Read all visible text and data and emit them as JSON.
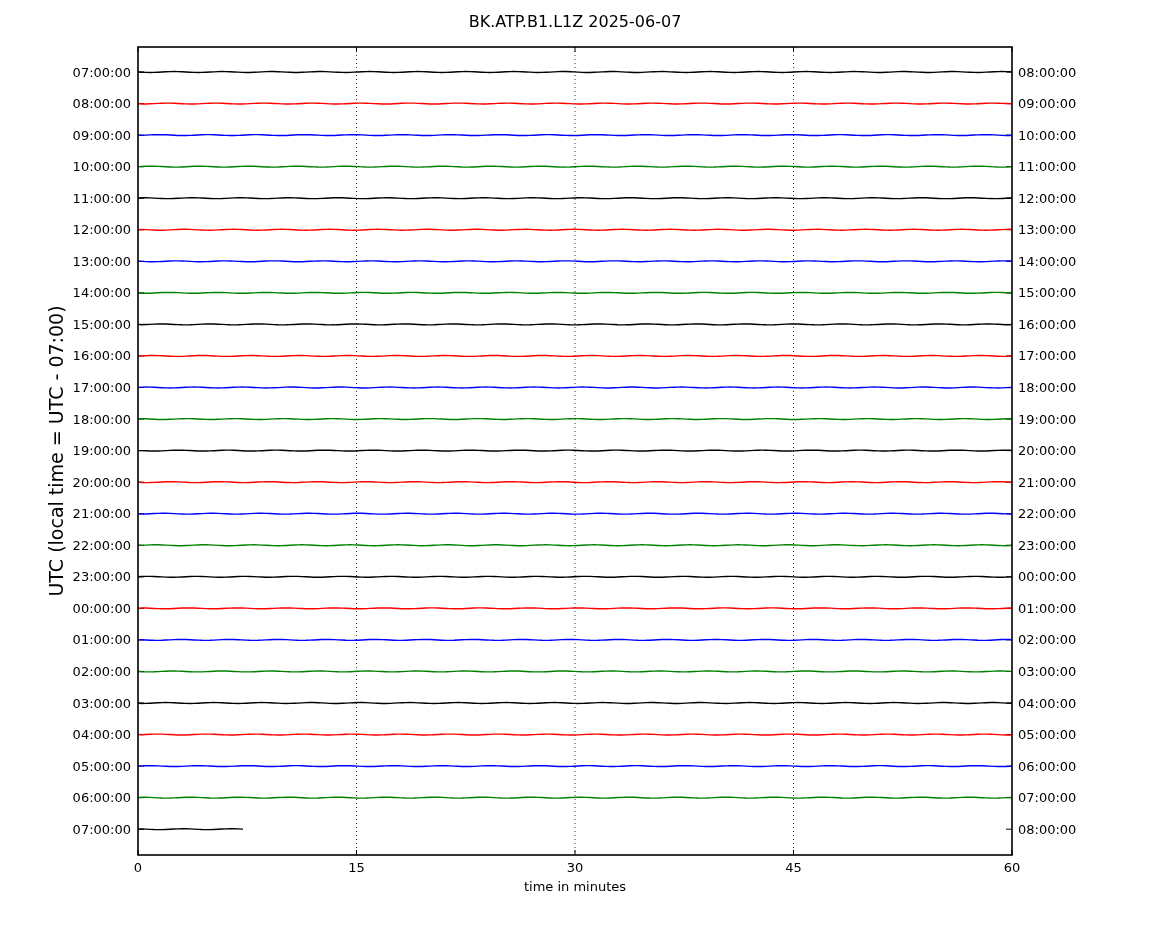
{
  "title": "BK.ATP.B1.L1Z 2025-06-07",
  "ylabel": "UTC (local time = UTC - 07:00)",
  "xlabel": "time in minutes",
  "xticks": [
    "0",
    "15",
    "30",
    "45",
    "60"
  ],
  "rows": [
    {
      "left": "07:00:00",
      "right": "08:00:00",
      "color": "#000000",
      "level": 1
    },
    {
      "left": "08:00:00",
      "right": "09:00:00",
      "color": "#ff0000",
      "level": 1
    },
    {
      "left": "09:00:00",
      "right": "10:00:00",
      "color": "#0000ff",
      "level": 1
    },
    {
      "left": "10:00:00",
      "right": "11:00:00",
      "color": "#008000",
      "level": 1
    },
    {
      "left": "11:00:00",
      "right": "12:00:00",
      "color": "#000000",
      "level": 1
    },
    {
      "left": "12:00:00",
      "right": "13:00:00",
      "color": "#ff0000",
      "level": 1
    },
    {
      "left": "13:00:00",
      "right": "14:00:00",
      "color": "#0000ff",
      "level": 1
    },
    {
      "left": "14:00:00",
      "right": "15:00:00",
      "color": "#008000",
      "level": 1
    },
    {
      "left": "15:00:00",
      "right": "16:00:00",
      "color": "#000000",
      "level": 1
    },
    {
      "left": "16:00:00",
      "right": "17:00:00",
      "color": "#ff0000",
      "level": 1
    },
    {
      "left": "17:00:00",
      "right": "18:00:00",
      "color": "#0000ff",
      "level": 1
    },
    {
      "left": "18:00:00",
      "right": "19:00:00",
      "color": "#008000",
      "level": 1
    },
    {
      "left": "19:00:00",
      "right": "20:00:00",
      "color": "#000000",
      "level": 1
    },
    {
      "left": "20:00:00",
      "right": "21:00:00",
      "color": "#ff0000",
      "level": 1
    },
    {
      "left": "21:00:00",
      "right": "22:00:00",
      "color": "#0000ff",
      "level": 1
    },
    {
      "left": "22:00:00",
      "right": "23:00:00",
      "color": "#008000",
      "level": 1
    },
    {
      "left": "23:00:00",
      "right": "00:00:00",
      "color": "#000000",
      "level": 1
    },
    {
      "left": "00:00:00",
      "right": "01:00:00",
      "color": "#ff0000",
      "level": 1
    },
    {
      "left": "01:00:00",
      "right": "02:00:00",
      "color": "#0000ff",
      "level": 1
    },
    {
      "left": "02:00:00",
      "right": "03:00:00",
      "color": "#008000",
      "level": 1
    },
    {
      "left": "03:00:00",
      "right": "04:00:00",
      "color": "#000000",
      "level": 1
    },
    {
      "left": "04:00:00",
      "right": "05:00:00",
      "color": "#ff0000",
      "level": 1
    },
    {
      "left": "05:00:00",
      "right": "06:00:00",
      "color": "#0000ff",
      "level": 1
    },
    {
      "left": "06:00:00",
      "right": "07:00:00",
      "color": "#008000",
      "level": 1
    },
    {
      "left": "07:00:00",
      "right": "08:00:00",
      "color": "#000000",
      "level": 0.12
    }
  ]
}
